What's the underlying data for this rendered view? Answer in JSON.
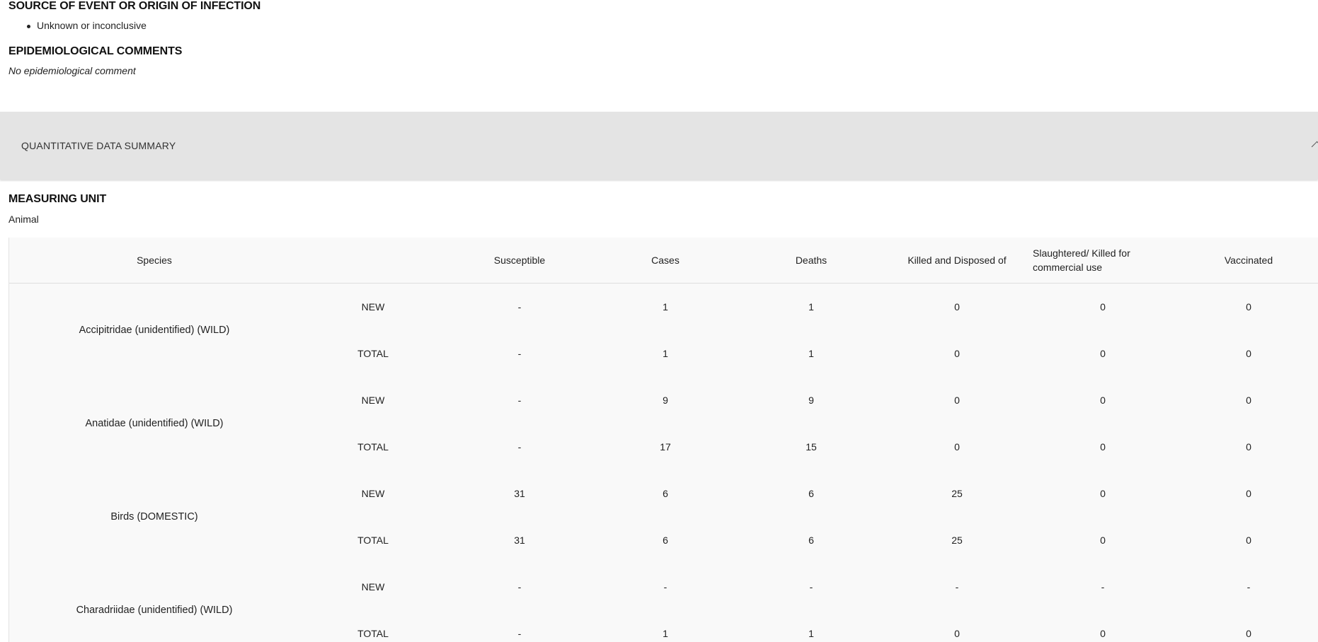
{
  "source": {
    "heading": "SOURCE OF EVENT OR ORIGIN OF INFECTION",
    "items": [
      "Unknown or inconclusive"
    ]
  },
  "epidemiological": {
    "heading": "EPIDEMIOLOGICAL COMMENTS",
    "comment": "No epidemiological comment"
  },
  "panel": {
    "title": "QUANTITATIVE DATA SUMMARY",
    "toggle_icon": "chevron-up-icon"
  },
  "measuring_unit": {
    "heading": "MEASURING UNIT",
    "value": "Animal"
  },
  "table": {
    "headers": {
      "species": "Species",
      "type": "",
      "susceptible": "Susceptible",
      "cases": "Cases",
      "deaths": "Deaths",
      "killed": "Killed and Disposed of",
      "slaughtered": "Slaughtered/ Killed for commercial use",
      "vaccinated": "Vaccinated"
    },
    "rows": [
      {
        "species": "Accipitridae (unidentified) (WILD)",
        "new": {
          "label": "NEW",
          "susceptible": "-",
          "cases": "1",
          "deaths": "1",
          "killed": "0",
          "slaughtered": "0",
          "vaccinated": "0"
        },
        "total": {
          "label": "TOTAL",
          "susceptible": "-",
          "cases": "1",
          "deaths": "1",
          "killed": "0",
          "slaughtered": "0",
          "vaccinated": "0"
        }
      },
      {
        "species": "Anatidae (unidentified) (WILD)",
        "new": {
          "label": "NEW",
          "susceptible": "-",
          "cases": "9",
          "deaths": "9",
          "killed": "0",
          "slaughtered": "0",
          "vaccinated": "0"
        },
        "total": {
          "label": "TOTAL",
          "susceptible": "-",
          "cases": "17",
          "deaths": "15",
          "killed": "0",
          "slaughtered": "0",
          "vaccinated": "0"
        }
      },
      {
        "species": "Birds (DOMESTIC)",
        "new": {
          "label": "NEW",
          "susceptible": "31",
          "cases": "6",
          "deaths": "6",
          "killed": "25",
          "slaughtered": "0",
          "vaccinated": "0"
        },
        "total": {
          "label": "TOTAL",
          "susceptible": "31",
          "cases": "6",
          "deaths": "6",
          "killed": "25",
          "slaughtered": "0",
          "vaccinated": "0"
        }
      },
      {
        "species": "Charadriidae (unidentified) (WILD)",
        "new": {
          "label": "NEW",
          "susceptible": "-",
          "cases": "-",
          "deaths": "-",
          "killed": "-",
          "slaughtered": "-",
          "vaccinated": "-"
        },
        "total": {
          "label": "TOTAL",
          "susceptible": "-",
          "cases": "1",
          "deaths": "1",
          "killed": "0",
          "slaughtered": "0",
          "vaccinated": "0"
        }
      }
    ]
  }
}
